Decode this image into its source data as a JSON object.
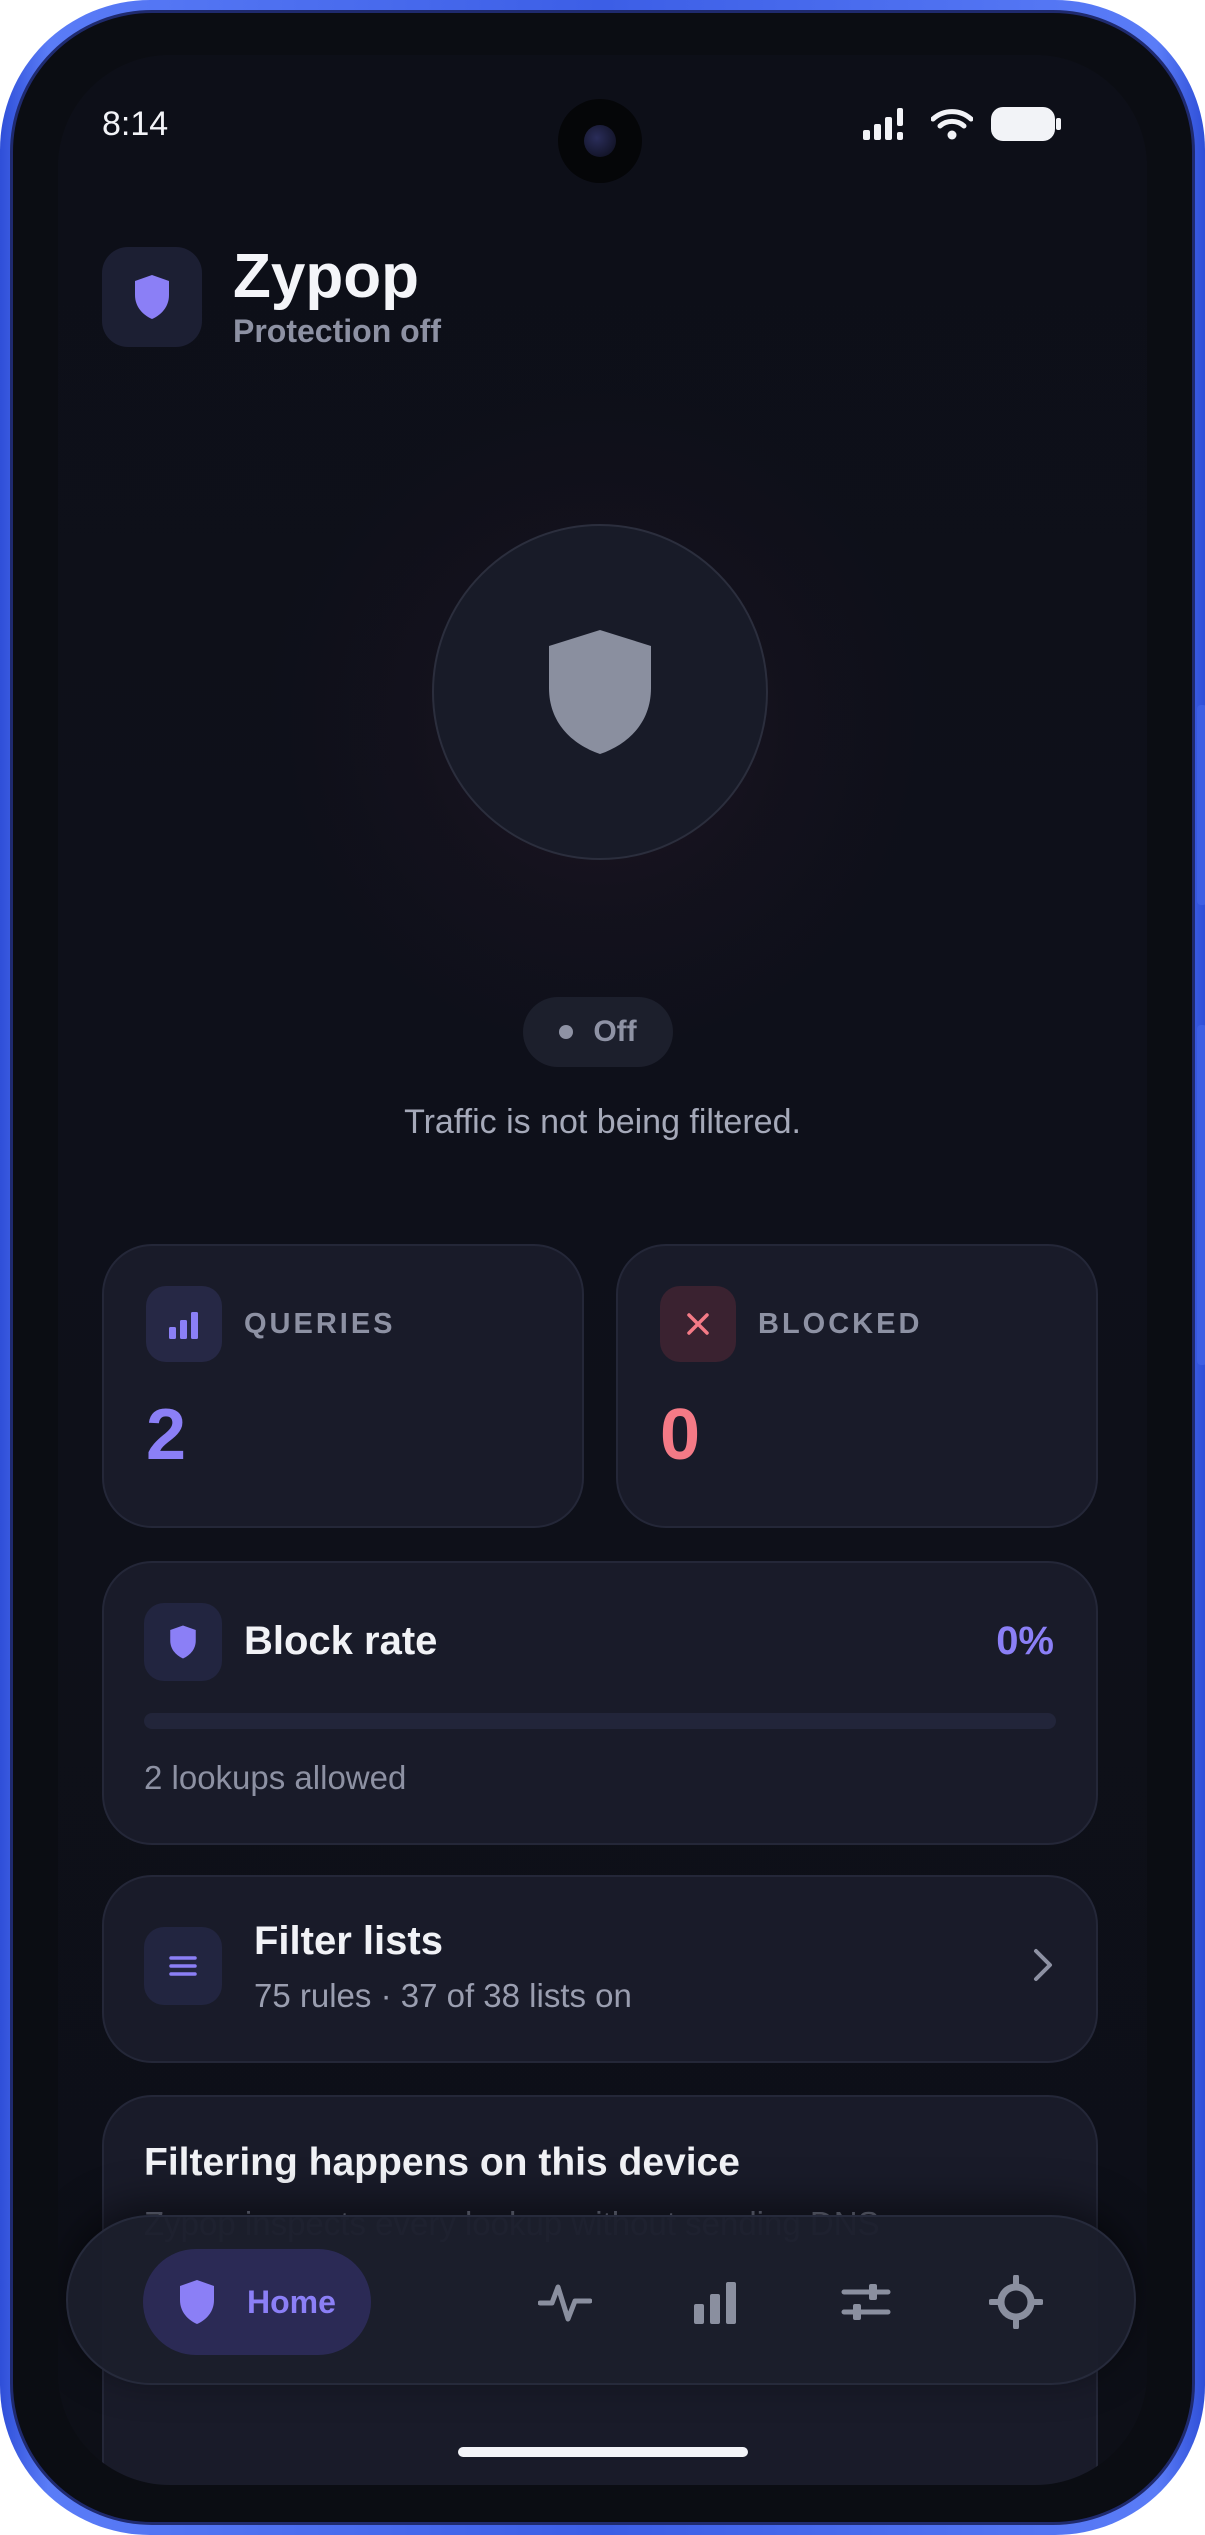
{
  "status_bar": {
    "time": "8:14"
  },
  "header": {
    "app_name": "Zypop",
    "status_text": "Protection off"
  },
  "hero": {
    "toggle_label": "Off",
    "description": "Traffic is not being filtered."
  },
  "stats": {
    "queries": {
      "label": "QUERIES",
      "value": "2",
      "color": "#8b7ff6"
    },
    "blocked": {
      "label": "BLOCKED",
      "value": "0",
      "color": "#f47a86"
    }
  },
  "block_rate": {
    "title": "Block rate",
    "percent_label": "0%",
    "progress": 0,
    "subtitle": "2 lookups allowed"
  },
  "filter_lists": {
    "title": "Filter lists",
    "subtitle": "75 rules · 37 of 38 lists on"
  },
  "on_device": {
    "title": "Filtering happens on this device",
    "body": "Zypop inspects every lookup without sending DNS"
  },
  "bottom_nav": {
    "home_label": "Home",
    "items": [
      "shield-icon",
      "activity-icon",
      "bar-chart-icon",
      "sliders-icon",
      "settings-icon"
    ]
  },
  "colors": {
    "accent": "#8b7ff6",
    "danger": "#f47a86",
    "background": "#0d0f18",
    "card": "#191b29",
    "frame": "#3c5ee6"
  }
}
